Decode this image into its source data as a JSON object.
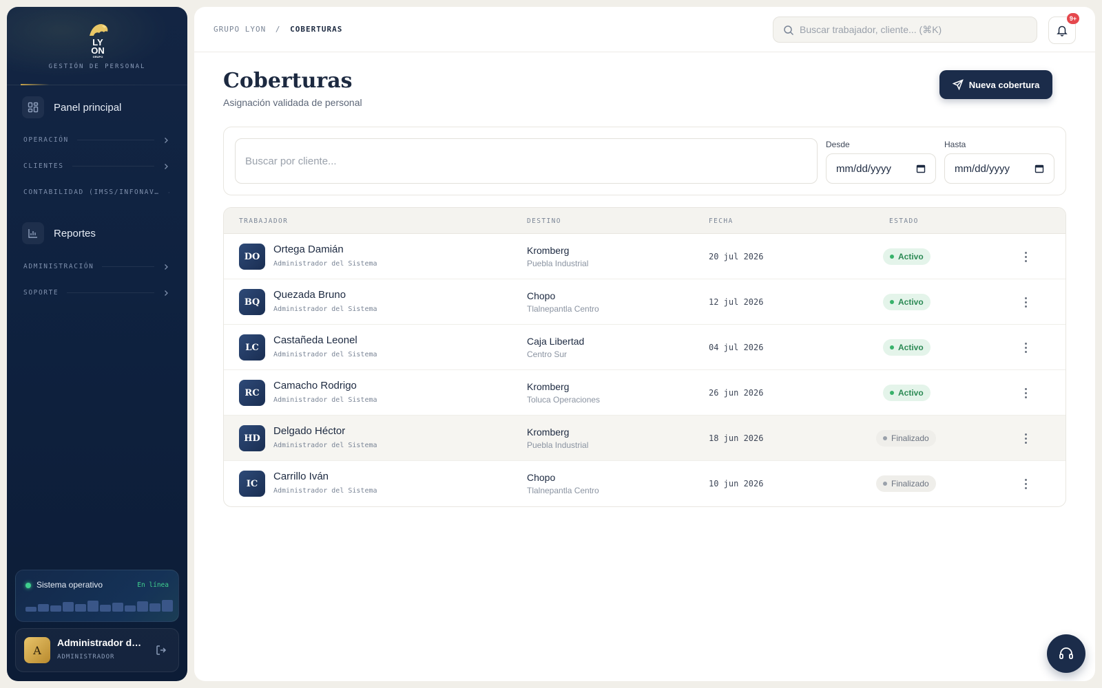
{
  "brand": {
    "logo_text": [
      "LY",
      "ON",
      "GRUPO"
    ],
    "subtitle": "GESTIÓN DE PERSONAL"
  },
  "sidebar": {
    "main_items": [
      {
        "label": "Panel principal",
        "icon": "dashboard-icon"
      },
      {
        "label": "Reportes",
        "icon": "bar-chart-icon"
      }
    ],
    "sections": [
      {
        "label": "OPERACIÓN"
      },
      {
        "label": "CLIENTES"
      },
      {
        "label": "CONTABILIDAD (IMSS/INFONAV…"
      },
      {
        "label": "ADMINISTRACIÓN"
      },
      {
        "label": "SOPORTE"
      }
    ]
  },
  "system_status": {
    "label": "Sistema operativo",
    "state": "En línea",
    "state_color": "#3fcf8e",
    "activity": [
      0.35,
      0.55,
      0.45,
      0.7,
      0.55,
      0.8,
      0.5,
      0.65,
      0.45,
      0.75,
      0.6,
      0.85
    ]
  },
  "user": {
    "initial": "A",
    "name": "Administrador del Sistema",
    "role": "ADMINISTRADOR"
  },
  "topbar": {
    "breadcrumb": {
      "root": "GRUPO LYON",
      "separator": "/",
      "current": "COBERTURAS"
    },
    "search_placeholder": "Buscar trabajador, cliente... (⌘K)",
    "notifications_badge": "9+"
  },
  "page": {
    "title": "Coberturas",
    "subtitle": "Asignación validada de personal",
    "new_button": "Nueva cobertura"
  },
  "filters": {
    "client_placeholder": "Buscar por cliente...",
    "from_label": "Desde",
    "to_label": "Hasta",
    "date_placeholder": "mm/dd/yyyy"
  },
  "table": {
    "columns": [
      "TRABAJADOR",
      "DESTINO",
      "FECHA",
      "ESTADO"
    ],
    "rows": [
      {
        "initials": "DO",
        "name": "Ortega Damián",
        "role": "Administrador del Sistema",
        "destination": "Kromberg",
        "location": "Puebla Industrial",
        "date": "20 jul 2026",
        "status": "Activo",
        "status_type": "active"
      },
      {
        "initials": "BQ",
        "name": "Quezada Bruno",
        "role": "Administrador del Sistema",
        "destination": "Chopo",
        "location": "Tlalnepantla Centro",
        "date": "12 jul 2026",
        "status": "Activo",
        "status_type": "active"
      },
      {
        "initials": "LC",
        "name": "Castañeda Leonel",
        "role": "Administrador del Sistema",
        "destination": "Caja Libertad",
        "location": "Centro Sur",
        "date": "04 jul 2026",
        "status": "Activo",
        "status_type": "active"
      },
      {
        "initials": "RC",
        "name": "Camacho Rodrigo",
        "role": "Administrador del Sistema",
        "destination": "Kromberg",
        "location": "Toluca Operaciones",
        "date": "26 jun 2026",
        "status": "Activo",
        "status_type": "active"
      },
      {
        "initials": "HD",
        "name": "Delgado Héctor",
        "role": "Administrador del Sistema",
        "destination": "Kromberg",
        "location": "Puebla Industrial",
        "date": "18 jun 2026",
        "status": "Finalizado",
        "status_type": "done"
      },
      {
        "initials": "IC",
        "name": "Carrillo Iván",
        "role": "Administrador del Sistema",
        "destination": "Chopo",
        "location": "Tlalnepantla Centro",
        "date": "10 jun 2026",
        "status": "Finalizado",
        "status_type": "done"
      }
    ]
  },
  "colors": {
    "navy": "#1b2c4a",
    "gold": "#c9a449",
    "active_green": "#38b26b"
  }
}
